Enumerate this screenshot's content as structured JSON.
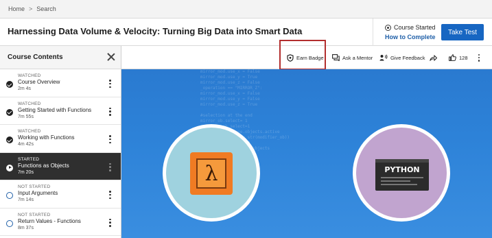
{
  "breadcrumb": {
    "home": "Home",
    "separator": ">",
    "current": "Search"
  },
  "course": {
    "title": "Harnessing Data Volume & Velocity: Turning Big Data into Smart Data"
  },
  "status": {
    "label": "Course Started",
    "link": "How to Complete"
  },
  "take_test": {
    "label": "Take Test"
  },
  "sidebar": {
    "title": "Course Contents",
    "items": [
      {
        "status": "WATCHED",
        "name": "Course Overview",
        "duration": "2m 4s",
        "state": "done"
      },
      {
        "status": "WATCHED",
        "name": "Getting Started with Functions",
        "duration": "7m 55s",
        "state": "done"
      },
      {
        "status": "WATCHED",
        "name": "Working with Functions",
        "duration": "4m 42s",
        "state": "done"
      },
      {
        "status": "STARTED",
        "name": "Functions as Objects",
        "duration": "7m 20s",
        "state": "active"
      },
      {
        "status": "NOT STARTED",
        "name": "Input Arguments",
        "duration": "7m 14s",
        "state": "todo"
      },
      {
        "status": "NOT STARTED",
        "name": "Return Values - Functions",
        "duration": "8m 37s",
        "state": "todo"
      }
    ]
  },
  "toolbar": {
    "earn_badge": "Earn Badge",
    "ask_mentor": "Ask a Mentor",
    "give_feedback": "Give Feedback",
    "likes": "128"
  },
  "video": {
    "python_label": "PYTHON",
    "lambda_symbol": "λ"
  },
  "colors": {
    "primary": "#1766c2",
    "highlight": "#b22d2d",
    "active_item": "#2f2f2f"
  }
}
